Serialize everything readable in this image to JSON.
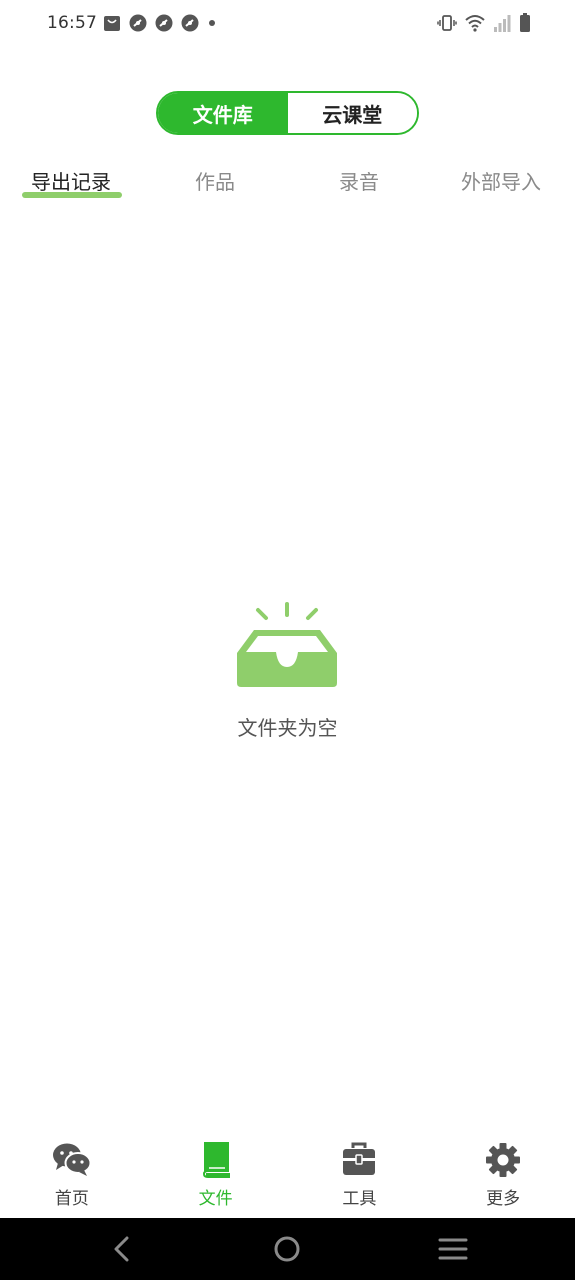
{
  "status_bar": {
    "time": "16:57",
    "left_icons": [
      "shopping-bag-icon",
      "speed-app-icon",
      "speed-app-icon",
      "speed-app-icon",
      "dot-icon"
    ],
    "right_icons": [
      "vibrate-icon",
      "wifi-icon",
      "signal-icon",
      "battery-icon"
    ]
  },
  "segmented": {
    "items": [
      "文件库",
      "云课堂"
    ],
    "selected": "文件库"
  },
  "tabs": {
    "items": [
      "导出记录",
      "作品",
      "录音",
      "外部导入"
    ],
    "selected": "导出记录"
  },
  "empty_state": {
    "icon": "empty-inbox-icon",
    "text": "文件夹为空"
  },
  "bottom_nav": {
    "items": [
      {
        "label": "首页",
        "icon": "chat-bubbles-icon"
      },
      {
        "label": "文件",
        "icon": "book-icon"
      },
      {
        "label": "工具",
        "icon": "toolbox-icon"
      },
      {
        "label": "更多",
        "icon": "gear-icon"
      }
    ],
    "selected": "文件"
  },
  "system_nav": {
    "buttons": [
      "back-icon",
      "home-icon",
      "menu-icon"
    ]
  },
  "colors": {
    "accent": "#2eb82e",
    "tab_indicator": "#8fce6b",
    "empty_icon": "#8fce6b",
    "inactive_text": "#8a8a8a"
  }
}
